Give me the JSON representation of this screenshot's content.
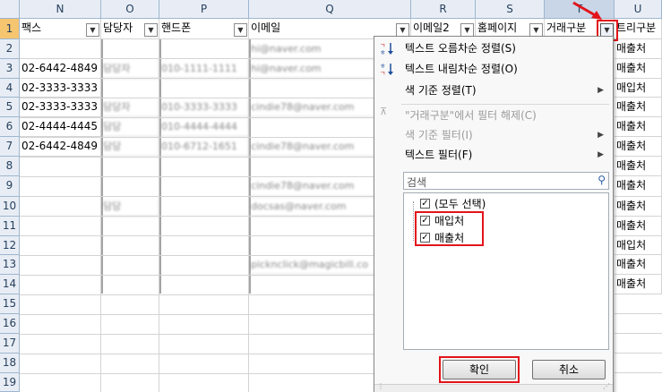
{
  "columns": [
    "N",
    "O",
    "P",
    "Q",
    "R",
    "S",
    "T",
    "U"
  ],
  "rows": [
    "1",
    "2",
    "3",
    "4",
    "5",
    "6",
    "7",
    "8",
    "9",
    "10",
    "11",
    "12",
    "13",
    "14",
    "15",
    "16",
    "17",
    "18",
    "19"
  ],
  "headers": {
    "N": "팩스",
    "O": "담당자",
    "P": "핸드폰",
    "Q": "이메일",
    "R": "이메일2",
    "S": "홈페이지",
    "T": "거래구분",
    "U": "트리구분"
  },
  "fax": [
    "",
    "02-6442-4849",
    "02-3333-3333",
    "02-3333-3333",
    "02-4444-4445",
    "02-6442-4849"
  ],
  "contact": [
    "",
    "담당자",
    "",
    "담당자",
    "담당",
    "담당",
    "",
    "",
    "담당"
  ],
  "mobile": [
    "",
    "010-1111-1111",
    "",
    "010-3333-3333",
    "010-4444-4444",
    "010-6712-1651"
  ],
  "email": [
    "hi@naver.com",
    "hi@naver.com",
    "",
    "cindie78@naver.com",
    "",
    "cindie78@naver.com",
    "",
    "cindie78@naver.com",
    "docsas@naver.com",
    "",
    "",
    "picknclick@magicbill.co"
  ],
  "col_u": [
    "매출처",
    "매출처",
    "매입처",
    "매출처",
    "매출처",
    "매출처",
    "매출처",
    "매출처",
    "매출처",
    "매출처",
    "매입처",
    "매출처",
    "매출처"
  ],
  "menu": {
    "sort_asc": "텍스트 오름차순 정렬(S)",
    "sort_desc": "텍스트 내림차순 정렬(O)",
    "sort_color": "색 기준 정렬(T)",
    "clear_filter": "\"거래구분\"에서 필터 해제(C)",
    "filter_color": "색 기준 필터(I)",
    "text_filter": "텍스트 필터(F)",
    "search_placeholder": "검색",
    "items": [
      {
        "label": "(모두 선택)",
        "checked": true
      },
      {
        "label": "매입처",
        "checked": true
      },
      {
        "label": "매출처",
        "checked": true
      }
    ],
    "ok": "확인",
    "cancel": "취소"
  }
}
